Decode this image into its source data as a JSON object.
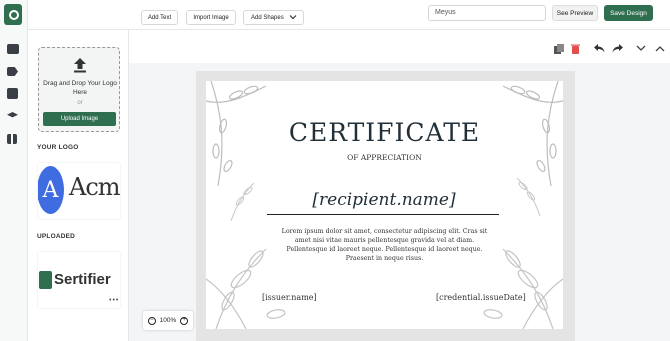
{
  "sidebar_rail": {
    "icons": [
      "sertifier-logo-icon",
      "certificate-icon",
      "tag-icon",
      "image-icon",
      "layers-icon",
      "grid-icon"
    ]
  },
  "header": {
    "search_value": "Meyus",
    "preview_label": "See Preview",
    "save_label": "Save Design"
  },
  "toolbar": {
    "add_text": "Add Text",
    "import_image": "Import Image",
    "add_shapes": "Add Shapes",
    "icons": [
      "duplicate-icon",
      "delete-icon",
      "undo-icon",
      "redo-icon",
      "chevron-down-icon",
      "chevron-up-icon"
    ]
  },
  "panel": {
    "upload": {
      "drop_text": "Drag and Drop Your Logo Here",
      "or_text": "or",
      "button_label": "Upload Image"
    },
    "your_logo_heading": "YOUR LOGO",
    "your_logo": {
      "initial": "A",
      "name": "Acme"
    },
    "uploaded_heading": "UPLOADED",
    "uploaded_logo": {
      "name": "Sertifier",
      "menu": "•••"
    }
  },
  "zoom": {
    "level": "100%"
  },
  "certificate": {
    "title": "CERTIFICATE",
    "subtitle": "OF APPRECIATION",
    "recipient": "[recipient.name]",
    "body_lines": [
      "Lorem ipsum dolor sit amet, consectetur adipiscing elit. Cras sit",
      "amet nisi vitae mauris pellentesque gravida vel at diam.",
      "Pellentesque id laoreet neque. Pellentesque id laoreet neque.",
      "Praesent in neque risus."
    ],
    "issuer": "[issuer.name]",
    "credential_date": "[credential.issueDate]"
  },
  "colors": {
    "brand_green": "#2f6e4f",
    "delete_red": "#e05050",
    "acme_blue": "#3f6ce0"
  }
}
